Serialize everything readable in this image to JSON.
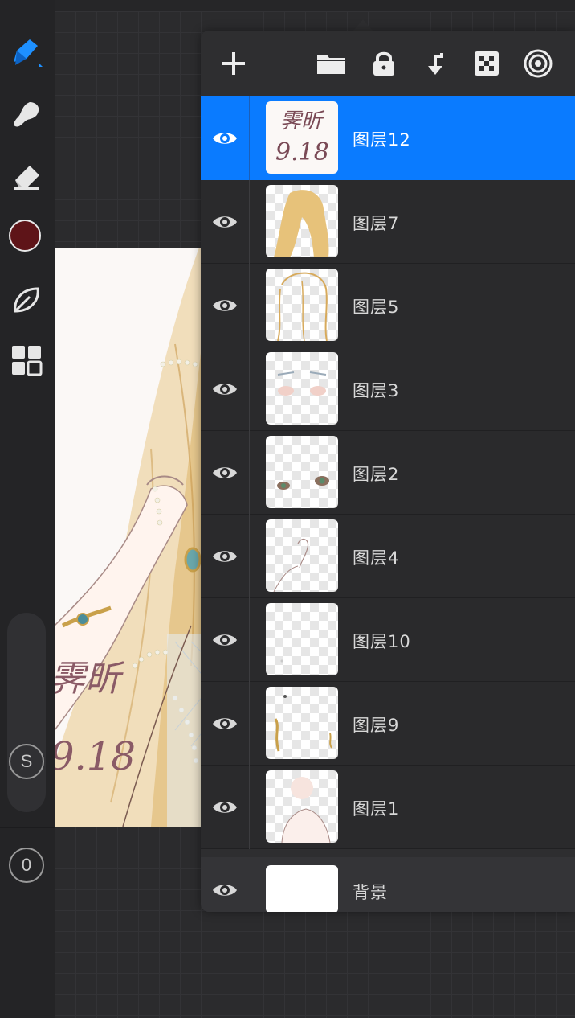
{
  "toolbar": {
    "tools": [
      {
        "name": "paint-brush-icon",
        "active": true
      },
      {
        "name": "smudge-icon"
      },
      {
        "name": "eraser-icon"
      },
      {
        "name": "color-swatch"
      },
      {
        "name": "leaf-icon"
      },
      {
        "name": "grid-icon"
      }
    ],
    "active_color": "#5e1418",
    "accent": "#1e90ff",
    "symmetry_label": "S",
    "zero_label": "0"
  },
  "canvas": {
    "signature_line1": "霁昕",
    "signature_line2": "9.18"
  },
  "layers_panel": {
    "actions": [
      {
        "name": "add-layer-icon"
      },
      {
        "name": "folder-icon"
      },
      {
        "name": "lock-icon"
      },
      {
        "name": "merge-down-icon"
      },
      {
        "name": "alpha-lock-icon"
      },
      {
        "name": "target-icon"
      }
    ],
    "layers": [
      {
        "label": "图层12",
        "selected": true,
        "visible": true
      },
      {
        "label": "图层7",
        "visible": true
      },
      {
        "label": "图层5",
        "visible": true
      },
      {
        "label": "图层3",
        "visible": true
      },
      {
        "label": "图层2",
        "visible": true
      },
      {
        "label": "图层4",
        "visible": true
      },
      {
        "label": "图层10",
        "visible": true
      },
      {
        "label": "图层9",
        "visible": true
      },
      {
        "label": "图层1",
        "visible": true
      }
    ],
    "background_layer": {
      "label": "背景",
      "visible": true
    },
    "selection_color": "#0a7bff",
    "thumb_sign_line1": "霁昕",
    "thumb_sign_line2": "9.18"
  }
}
